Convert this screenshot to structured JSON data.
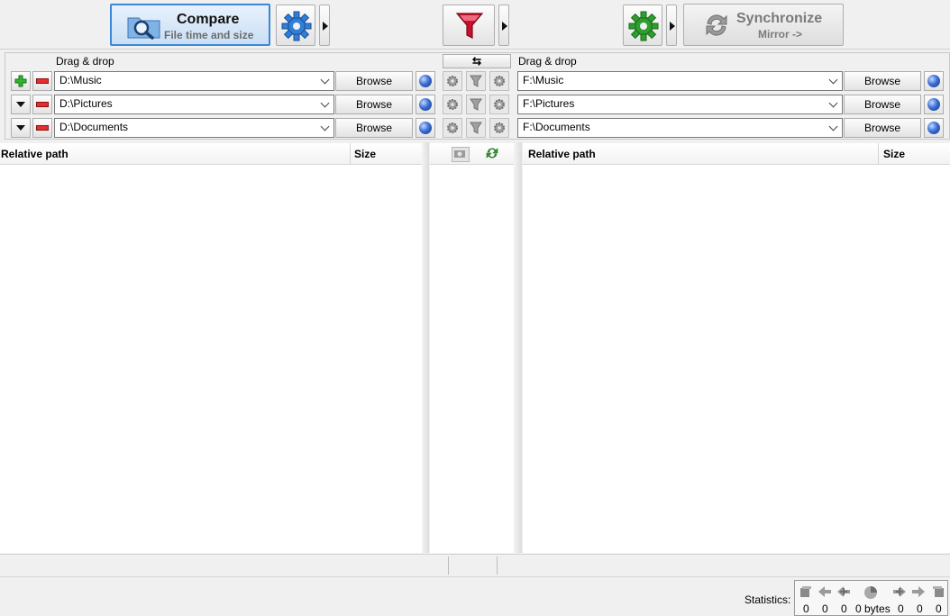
{
  "toolbar": {
    "compare_title": "Compare",
    "compare_sub": "File time and size",
    "sync_title": "Synchronize",
    "sync_sub": "Mirror ->"
  },
  "panel": {
    "left_drag_label": "Drag & drop",
    "right_drag_label": "Drag & drop",
    "swap_glyph": "⇆",
    "browse_label": "Browse",
    "pairs": [
      {
        "left": "D:\\Music",
        "right": "F:\\Music"
      },
      {
        "left": "D:\\Pictures",
        "right": "F:\\Pictures"
      },
      {
        "left": "D:\\Documents",
        "right": "F:\\Documents"
      }
    ]
  },
  "grid_left": {
    "col_path": "Relative path",
    "col_size": "Size"
  },
  "grid_right": {
    "col_path": "Relative path",
    "col_size": "Size"
  },
  "stats": {
    "label": "Statistics:",
    "values": [
      "0",
      "0",
      "0",
      "0 bytes",
      "0",
      "0",
      "0"
    ]
  },
  "colors": {
    "accent": "#3b87d6",
    "filter_red": "#c8102e",
    "gear_green": "#2e9e2e",
    "gear_blue": "#2f7fd8"
  }
}
